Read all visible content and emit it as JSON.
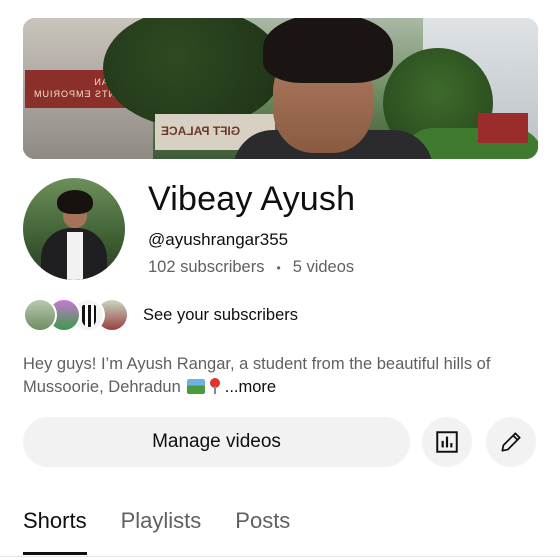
{
  "banner": {
    "sign_text_1": "HIMALAYAN GARMENTS EMPORIUM",
    "sign_text_2": "GIFT PALACE"
  },
  "channel": {
    "name": "Vibeay Ayush",
    "handle": "@ayushrangar355",
    "subscribers": "102 subscribers",
    "separator": "•",
    "videos": "5 videos"
  },
  "subscribers_row": {
    "label": "See your subscribers"
  },
  "description": {
    "text": "Hey guys! I’m Ayush Rangar, a student from the beautiful hills of Mussoorie, Dehradun",
    "more_label": "...more"
  },
  "actions": {
    "manage_videos_label": "Manage videos",
    "analytics_icon": "analytics-icon",
    "edit_icon": "pencil-icon"
  },
  "tabs": [
    {
      "label": "Shorts",
      "active": true
    },
    {
      "label": "Playlists",
      "active": false
    },
    {
      "label": "Posts",
      "active": false
    }
  ],
  "colors": {
    "primary_text": "#0f0f0f",
    "secondary_text": "#606060",
    "button_bg": "#f2f2f2"
  }
}
